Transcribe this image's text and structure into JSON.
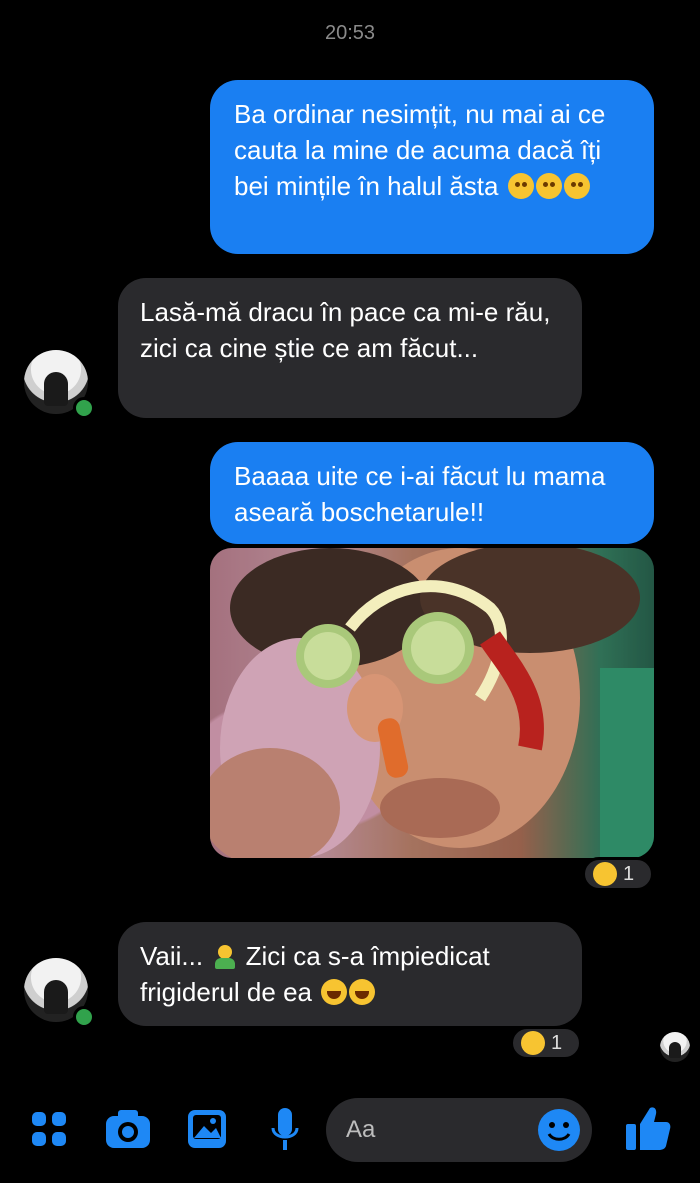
{
  "status": {
    "time": "20:53"
  },
  "messages": [
    {
      "side": "out",
      "text": "Ba ordinar nesimțit, nu mai ai ce cauta la mine de acuma dacă îți bei mințile în halul ăsta"
    },
    {
      "side": "in",
      "text": "Lasă-mă dracu în pace ca mi-e rău, zici ca cine știe ce am făcut..."
    },
    {
      "side": "out",
      "text": "Baaaa uite ce i-ai făcut lu mama aseară boschetarule!!"
    },
    {
      "side": "in",
      "text_a": "Vaii...",
      "text_b": "Zici ca s-a împiedicat frigiderul de ea"
    }
  ],
  "reactions": [
    {
      "emoji": "laugh-emoji",
      "count": "1"
    },
    {
      "emoji": "angry-emoji",
      "count": "1"
    }
  ],
  "composer": {
    "placeholder": "Aa"
  },
  "colors": {
    "accent": "#1a7ff2",
    "bubble_in": "#2a2a2d",
    "online": "#31a24c"
  }
}
